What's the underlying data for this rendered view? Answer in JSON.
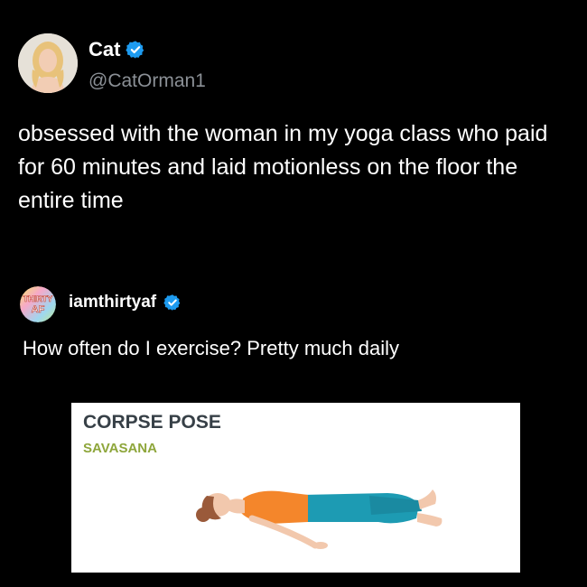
{
  "tweet": {
    "display_name": "Cat",
    "handle": "@CatOrman1",
    "text": "obsessed with the woman in my yoga class who paid for 60 minutes and laid motionless on the floor the entire time",
    "verified_icon": "verified-badge-icon"
  },
  "quote": {
    "username": "iamthirtyaf",
    "avatar_line1": "THIRTY",
    "avatar_line2": "AF",
    "text": "How often do I exercise? Pretty much daily",
    "verified_icon": "verified-badge-icon"
  },
  "pose_card": {
    "title": "CORPSE POSE",
    "subtitle": "SAVASANA"
  },
  "colors": {
    "background": "#000000",
    "verified_blue": "#1d9bf0",
    "handle_gray": "#8b9096",
    "pose_title": "#374047",
    "pose_subtitle": "#8ea63b",
    "shirt_orange": "#f4862b",
    "pants_teal": "#1d9bb3"
  }
}
